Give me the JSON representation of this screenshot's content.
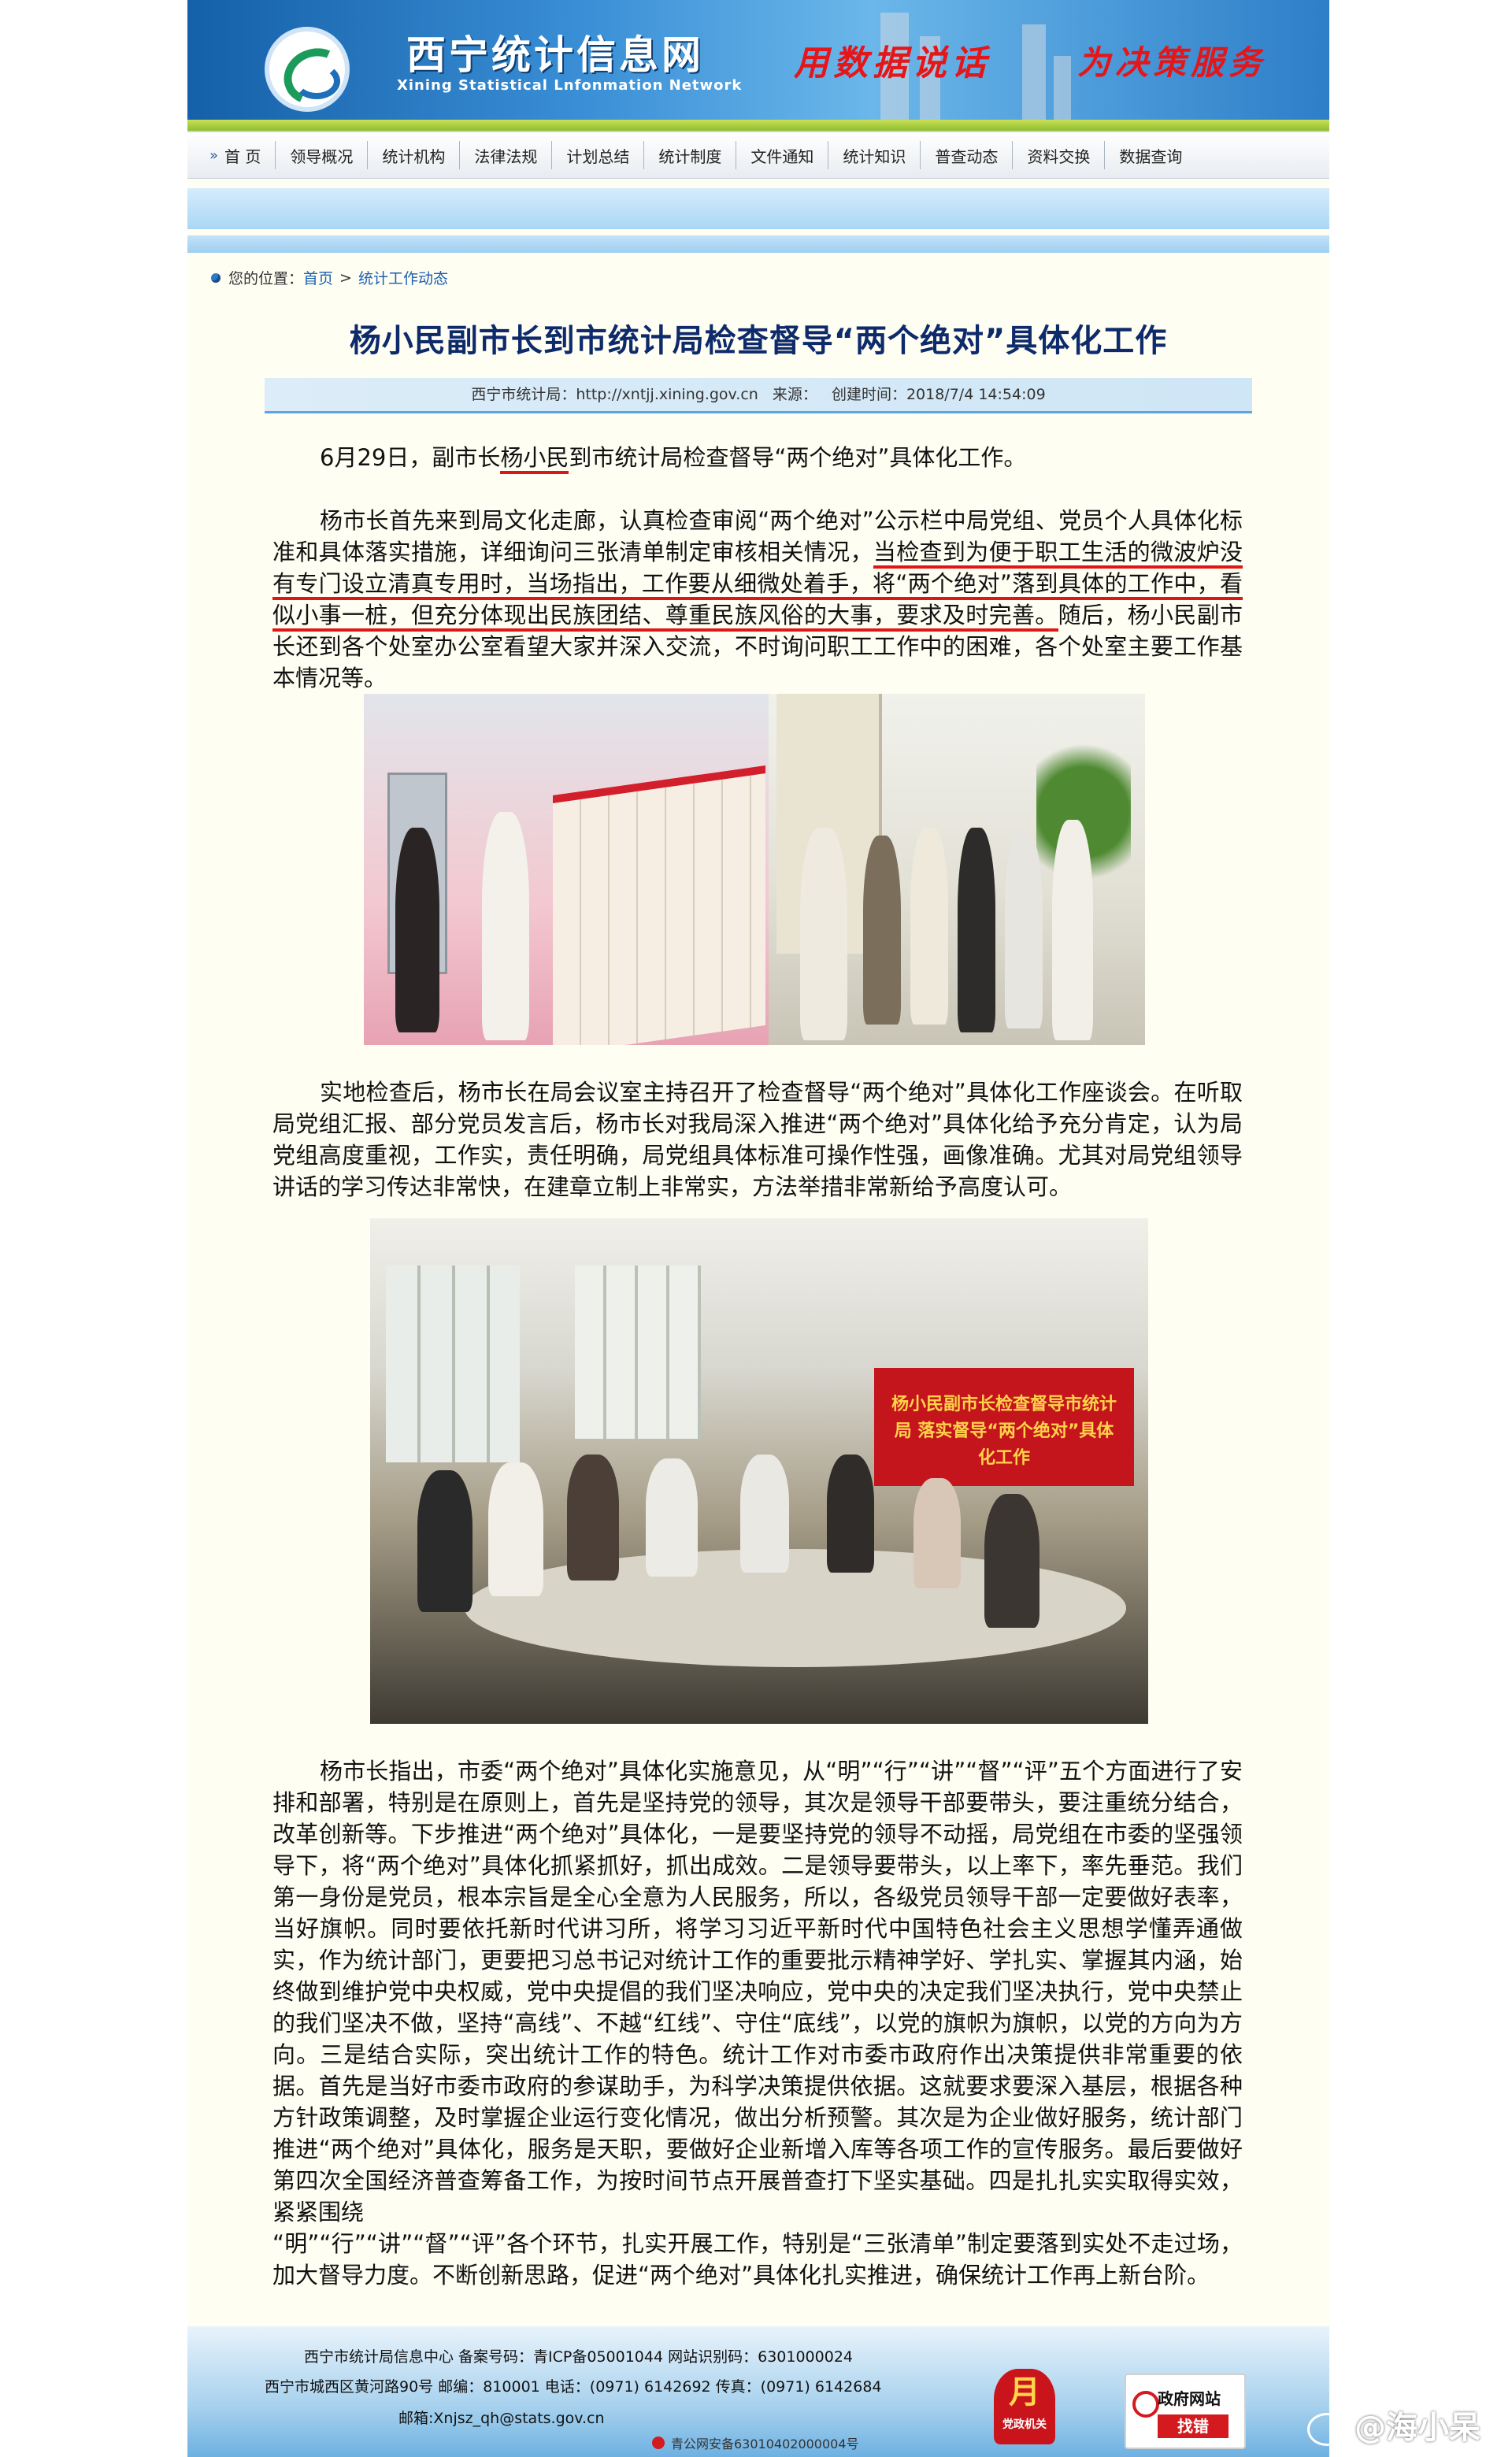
{
  "header": {
    "site_title": "西宁统计信息网",
    "site_subtitle": "Xining Statistical Lnfonmation Network",
    "slogan_left": "用数据说话",
    "slogan_right": "为决策服务"
  },
  "nav": {
    "items": [
      "首 页",
      "领导概况",
      "统计机构",
      "法律法规",
      "计划总结",
      "统计制度",
      "文件通知",
      "统计知识",
      "普查动态",
      "资料交换",
      "数据查询"
    ]
  },
  "breadcrumb": {
    "prefix": "您的位置：",
    "home": "首页",
    "separator": ">",
    "current": "统计工作动态"
  },
  "article": {
    "title": "杨小民副市长到市统计局检查督导“两个绝对”具体化工作",
    "source": "西宁市统计局：http://xntjj.xining.gov.cn",
    "from_label": "来源：",
    "created": "创建时间：2018/7/4 14:54:09",
    "p1_a": "6月29日，副市长",
    "p1_name": "杨小民",
    "p1_b": "到市统计局检查督导“两个绝对”具体化工作。",
    "p2_a": "杨市长首先来到局文化走廊，认真检查审阅“两个绝对”公示栏中局党组、党员个人具体化标准和具体落实措施，详细询问三张清单制定审核相关情况，",
    "p2_underline": "当检查到为便于职工生活的微波炉没有专门设立清真专用时，当场指出，工作要从细微处着手，将“两个绝对”落到具体的工作中，看似小事一桩，但充分体现出民族团结、尊重民族风俗的大事，要求及时完善。",
    "p2_b": "随后，杨小民副市长还到各个处室办公室看望大家并深入交流，不时询问职工工作中的困难，各个处室主要工作基本情况等。",
    "p3": "实地检查后，杨市长在局会议室主持召开了检查督导“两个绝对”具体化工作座谈会。在听取局党组汇报、部分党员发言后，杨市长对我局深入推进“两个绝对”具体化给予充分肯定，认为局党组高度重视，工作实，责任明确，局党组具体标准可操作性强，画像准确。尤其对局党组领导讲话的学习传达非常快，在建章立制上非常实，方法举措非常新给予高度认可。",
    "p4": "杨市长指出，市委“两个绝对”具体化实施意见，从“明”“行”“讲”“督”“评”五个方面进行了安排和部署，特别是在原则上，首先是坚持党的领导，其次是领导干部要带头，要注重统分结合，改革创新等。下步推进“两个绝对”具体化，一是要坚持党的领导不动摇，局党组在市委的坚强领导下，将“两个绝对”具体化抓紧抓好，抓出成效。二是领导要带头，以上率下，率先垂范。我们第一身份是党员，根本宗旨是全心全意为人民服务，所以，各级党员领导干部一定要做好表率，当好旗帜。同时要依托新时代讲习所，将学习习近平新时代中国特色社会主义思想学懂弄通做实，作为统计部门，更要把习总书记对统计工作的重要批示精神学好、学扎实、掌握其内涵，始终做到维护党中央权威，党中央提倡的我们坚决响应，党中央的决定我们坚决执行，党中央禁止的我们坚决不做，坚持“高线”、不越“红线”、守住“底线”，以党的旗帜为旗帜，以党的方向为方向。三是结合实际，突出统计工作的特色。统计工作对市委市政府作出决策提供非常重要的依据。首先是当好市委市政府的参谋助手，为科学决策提供依据。这就要求要深入基层，根据各种方针政策调整，及时掌握企业运行变化情况，做出分析预警。其次是为企业做好服务，统计部门推进“两个绝对”具体化，服务是天职，要做好企业新增入库等各项工作的宣传服务。最后要做好第四次全国经济普查筹备工作，为按时间节点开展普查打下坚实基础。四是扎扎实实取得实效，紧紧围绕",
    "p5": "“明”“行”“讲”“督”“评”各个环节，扎实开展工作，特别是“三张清单”制定要落到实处不走过场，加大督导力度。不断创新思路，促进“两个绝对”具体化扎实推进，确保统计工作再上新台阶。",
    "banner_photo_text": "杨小民副市长检查督导市统计局 落实督导“两个绝对”具体化工作"
  },
  "footer": {
    "line1": "西宁市统计局信息中心    备案号码：青ICP备05001044    网站识别码：6301000024",
    "line2": "西宁市城西区黄河路90号 邮编：810001 电话：(0971) 6142692 传真：(0971) 6142684",
    "line3": "邮箱:Xnjsz_qh@stats.gov.cn",
    "police": "青公网安备63010402000004号",
    "party_badge": "党政机关",
    "gov_btn_top": "政府网站",
    "gov_btn_bottom": "找错"
  },
  "watermark": "@海小呆",
  "colors": {
    "title": "#0d2a6b",
    "underline": "#e01515",
    "link": "#1b5fb0"
  }
}
